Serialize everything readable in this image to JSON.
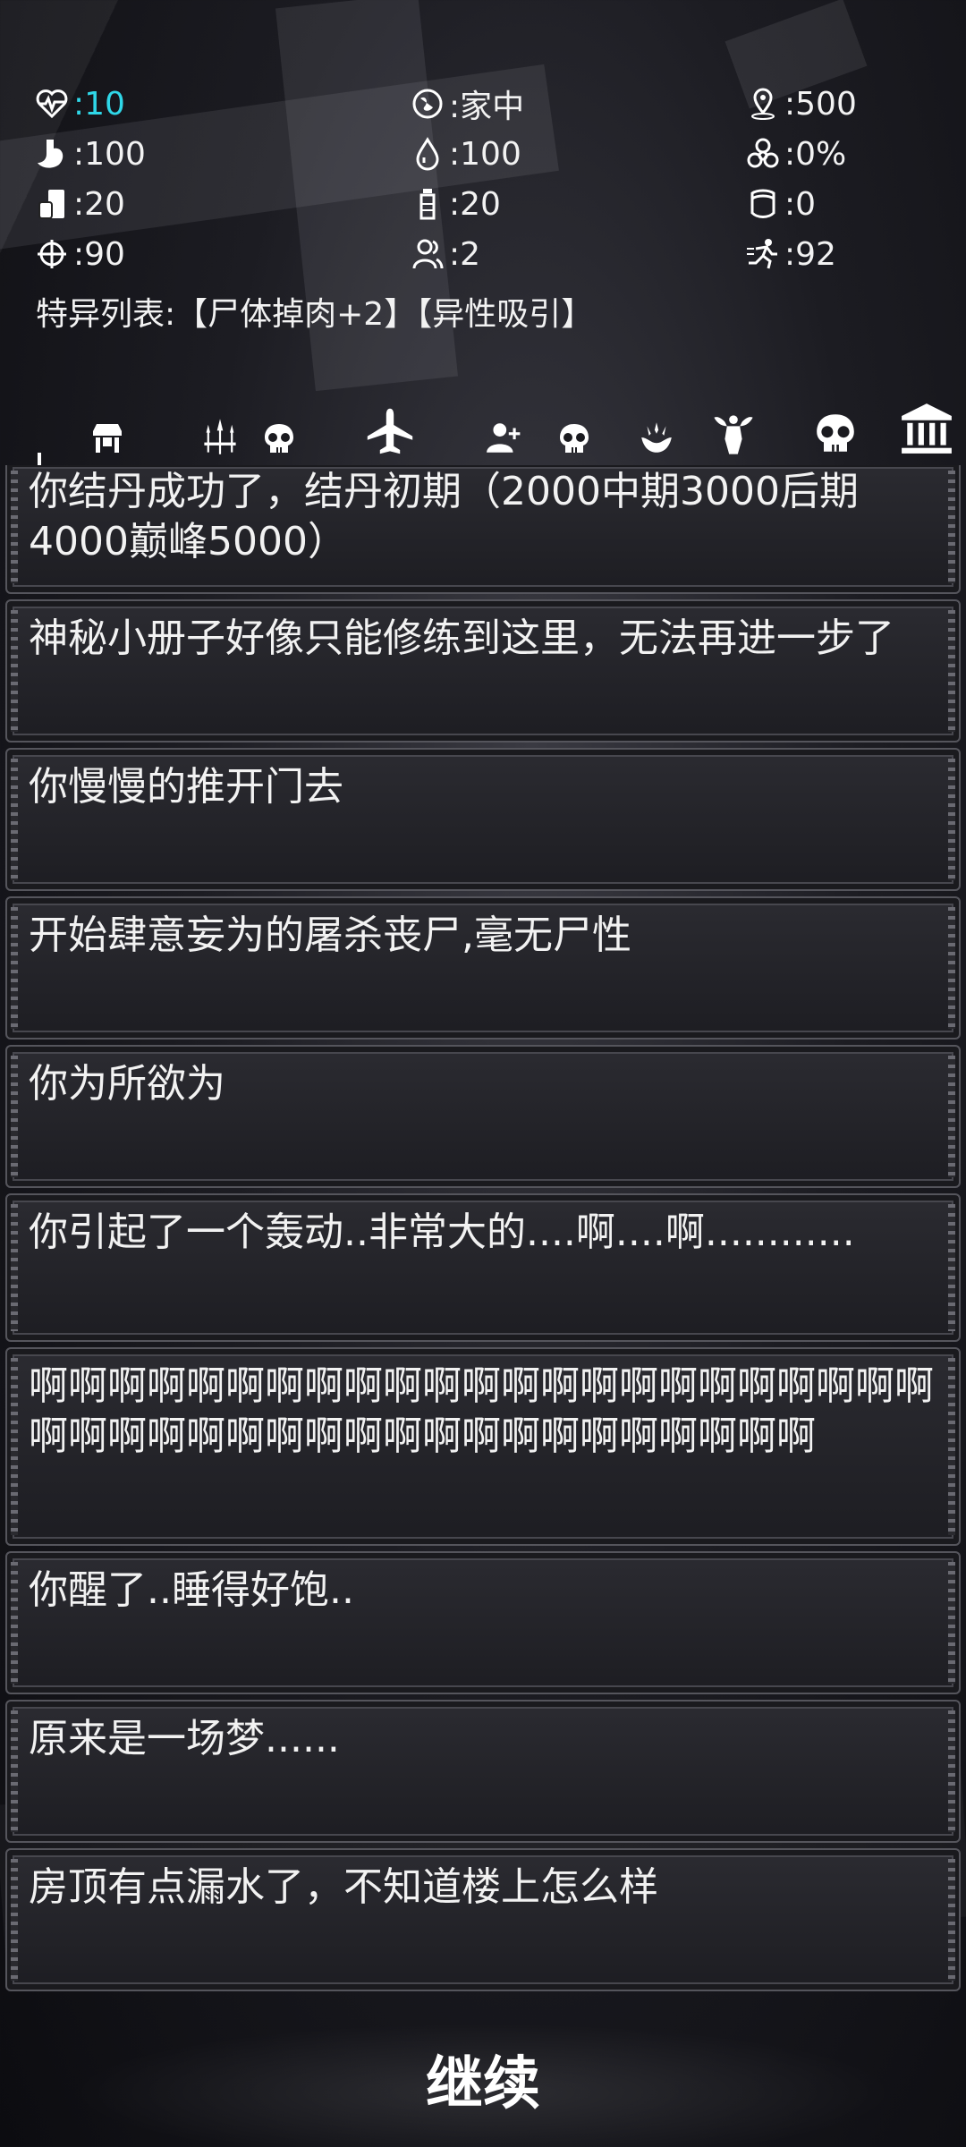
{
  "stats": {
    "health": ":10",
    "location": ":家中",
    "distance": ":500",
    "hunger": ":100",
    "thirst": ":100",
    "infection": ":0%",
    "food": ":20",
    "water": ":20",
    "defense": ":0",
    "accuracy": ":90",
    "companions": ":2",
    "agility": ":92"
  },
  "traits": "特异列表:【尸体掉肉+2】【异性吸引】",
  "icons": {
    "health": "heart-pulse-icon",
    "location": "globe-pin-icon",
    "distance": "map-pin-icon",
    "hunger": "stomach-icon",
    "thirst": "water-drop-icon",
    "infection": "biohazard-icon",
    "food": "food-can-icon",
    "water": "bottle-icon",
    "defense": "armor-icon",
    "accuracy": "crosshair-icon",
    "companions": "group-icon",
    "agility": "running-icon",
    "nav": [
      "shop-icon",
      "weapons-icon",
      "skull-icon",
      "airplane-icon",
      "add-person-icon",
      "skull-icon",
      "lotus-hand-icon",
      "muscle-icon",
      "skull-icon",
      "bank-icon"
    ]
  },
  "messages": [
    "你结丹成功了，结丹初期（2000中期3000后期4000巅峰5000）",
    "神秘小册子好像只能修练到这里，无法再进一步了",
    "你慢慢的推开门去",
    "开始肆意妄为的屠杀丧尸,毫无尸性",
    "你为所欲为",
    "你引起了一个轰动..非常大的....啊....啊............",
    "啊啊啊啊啊啊啊啊啊啊啊啊啊啊啊啊啊啊啊啊啊啊啊啊啊啊啊啊啊啊啊啊啊啊啊啊啊啊啊啊啊啊啊",
    "你醒了..睡得好饱..",
    "原来是一场梦......",
    "房顶有点漏水了，不知道楼上怎么样"
  ],
  "continue_label": "继续",
  "colors": {
    "health_value": "#2fd7e8",
    "text": "#f2f2f2"
  }
}
